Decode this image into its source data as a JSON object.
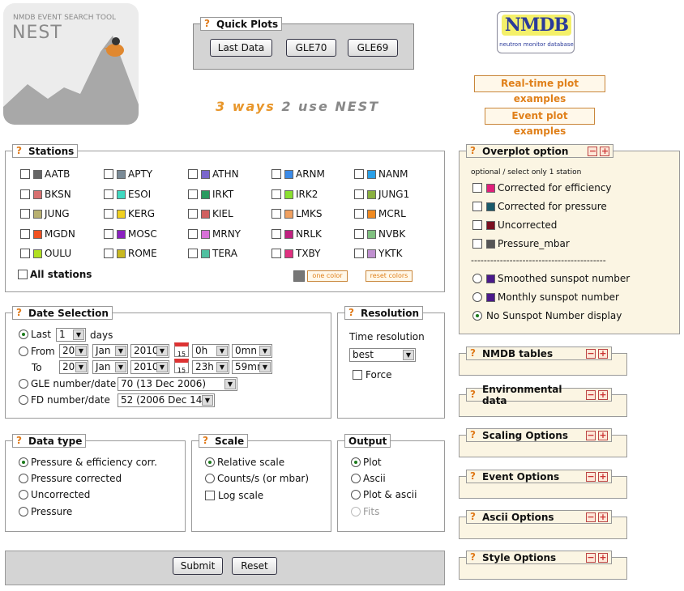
{
  "logo": {
    "tool": "NMDB EVENT SEARCH TOOL",
    "name": "NEST"
  },
  "quick_plots": {
    "title": "Quick Plots",
    "buttons": [
      "Last Data",
      "GLE70",
      "GLE69"
    ]
  },
  "tagline": {
    "a": "3 ways",
    "b": "2 use",
    "c": "NEST"
  },
  "nmdb_logo": {
    "text": "NMDB",
    "sub": "neutron monitor database"
  },
  "links": {
    "realtime": "Real-time plot examples",
    "event": "Event plot examples"
  },
  "stations": {
    "title": "Stations",
    "rows": [
      [
        {
          "n": "AATB",
          "c": "#666666"
        },
        {
          "n": "APTY",
          "c": "#7a8a96"
        },
        {
          "n": "ATHN",
          "c": "#7a66cc"
        },
        {
          "n": "ARNM",
          "c": "#3a8ae8"
        },
        {
          "n": "NANM",
          "c": "#2aa0e8"
        }
      ],
      [
        {
          "n": "BKSN",
          "c": "#d87070"
        },
        {
          "n": "ESOI",
          "c": "#40d8c0"
        },
        {
          "n": "IRKT",
          "c": "#2a9a60"
        },
        {
          "n": "IRK2",
          "c": "#8ae030"
        },
        {
          "n": "JUNG1",
          "c": "#8ab040"
        }
      ],
      [
        {
          "n": "JUNG",
          "c": "#b8b070"
        },
        {
          "n": "KERG",
          "c": "#f0d020"
        },
        {
          "n": "KIEL",
          "c": "#d06060"
        },
        {
          "n": "LMKS",
          "c": "#f0a060"
        },
        {
          "n": "MCRL",
          "c": "#f08a20"
        }
      ],
      [
        {
          "n": "MGDN",
          "c": "#f05020"
        },
        {
          "n": "MOSC",
          "c": "#8a20c0"
        },
        {
          "n": "MRNY",
          "c": "#d870d8"
        },
        {
          "n": "NRLK",
          "c": "#c02080"
        },
        {
          "n": "NVBK",
          "c": "#80c080"
        }
      ],
      [
        {
          "n": "OULU",
          "c": "#b0e020"
        },
        {
          "n": "ROME",
          "c": "#c8b820"
        },
        {
          "n": "TERA",
          "c": "#50c0a0"
        },
        {
          "n": "TXBY",
          "c": "#e03080"
        },
        {
          "n": "YKTK",
          "c": "#c090d0"
        }
      ]
    ],
    "all_label": "All stations",
    "one_color": "one color",
    "reset_colors": "reset colors"
  },
  "overplot": {
    "title": "Overplot option",
    "note": "optional / select only 1 station",
    "items": [
      {
        "label": "Corrected for efficiency",
        "c": "#e0207a"
      },
      {
        "label": "Corrected for pressure",
        "c": "#1a5a6a"
      },
      {
        "label": "Uncorrected",
        "c": "#7a1020"
      },
      {
        "label": "Pressure_mbar",
        "c": "#555555"
      }
    ],
    "divider": "------------------------------------------",
    "sunspot": [
      {
        "label": "Smoothed sunspot number",
        "c": "#4a1a8a"
      },
      {
        "label": "Monthly sunspot number",
        "c": "#4a1a8a"
      },
      {
        "label": "No Sunspot Number display",
        "c": ""
      }
    ]
  },
  "date": {
    "title": "Date Selection",
    "last": "Last",
    "last_val": "1",
    "days": "days",
    "from": "From",
    "to": "To",
    "from_day": "20",
    "from_month": "Jan",
    "from_year": "2010",
    "from_h": "0h",
    "from_m": "0mn",
    "to_day": "20",
    "to_month": "Jan",
    "to_year": "2010",
    "to_h": "23h",
    "to_m": "59mn",
    "cal": "15",
    "gle": "GLE number/date",
    "gle_val": "70 (13 Dec 2006)",
    "fd": "FD number/date",
    "fd_val": "52 (2006 Dec 14)"
  },
  "resolution": {
    "title": "Resolution",
    "label": "Time resolution",
    "value": "best",
    "force": "Force"
  },
  "datatype": {
    "title": "Data type",
    "items": [
      "Pressure & efficiency corr.",
      "Pressure corrected",
      "Uncorrected",
      "Pressure"
    ]
  },
  "scale": {
    "title": "Scale",
    "relative": "Relative scale",
    "counts": "Counts/s (or mbar)",
    "log": "Log scale"
  },
  "output": {
    "title": "Output",
    "items": [
      "Plot",
      "Ascii",
      "Plot & ascii",
      "Fits"
    ]
  },
  "actions": {
    "submit": "Submit",
    "reset": "Reset"
  },
  "panels": [
    "NMDB tables",
    "Environmental data",
    "Scaling Options",
    "Event Options",
    "Ascii Options",
    "Style Options"
  ],
  "qmark": "?"
}
